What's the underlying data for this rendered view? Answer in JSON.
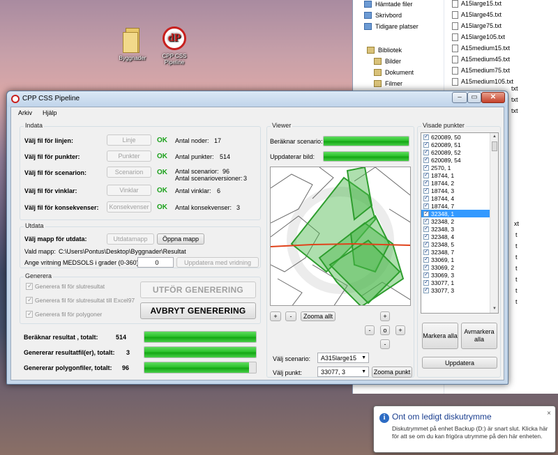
{
  "desktop": {
    "icons": [
      {
        "label": "Byggnader"
      },
      {
        "label": "CPP CSS Pipeline"
      }
    ]
  },
  "explorer": {
    "nav": [
      "Hämtade filer",
      "Skrivbord",
      "Tidigare platser",
      "Bibliotek",
      "Bilder",
      "Dokument",
      "Filmer"
    ],
    "files": [
      "A15large15.txt",
      "A15large45.txt",
      "A15large75.txt",
      "A15large105.txt",
      "A15medium15.txt",
      "A15medium45.txt",
      "A15medium75.txt",
      "A15medium105.txt"
    ],
    "right_stubs": [
      "txt",
      "txt",
      "txt",
      "xt",
      "t",
      "t",
      "t",
      "t",
      "t",
      "t",
      "t"
    ]
  },
  "window": {
    "title": "CPP CSS Pipeline",
    "menu": [
      "Arkiv",
      "Hjälp"
    ],
    "indata": {
      "title": "Indata",
      "rows": [
        {
          "label": "Välj fil för linjen:",
          "button": "Linje",
          "status": "OK",
          "info": "Antal noder:",
          "value": "17"
        },
        {
          "label": "Välj fil för punkter:",
          "button": "Punkter",
          "status": "OK",
          "info": "Antal punkter:",
          "value": "514"
        },
        {
          "label": "Välj fil för scenarion:",
          "button": "Scenarion",
          "status": "OK",
          "info": "Antal scenarior:",
          "value": "96",
          "info2": "Antal scenarioversioner:",
          "value2": "3"
        },
        {
          "label": "Välj fil för vinklar:",
          "button": "Vinklar",
          "status": "OK",
          "info": "Antal vinklar:",
          "value": "6"
        },
        {
          "label": "Välj fil för konsekvenser:",
          "button": "Konsekvenser",
          "status": "OK",
          "info": "Antal konsekvenser:",
          "value": "3"
        }
      ]
    },
    "utdata": {
      "title": "Utdata",
      "label": "Välj mapp för utdata:",
      "button": "Utdatamapp",
      "open_button": "Öppna mapp",
      "chosen_label": "Vald mapp:",
      "chosen_path": "C:\\Users\\Pontus\\Desktop\\Byggnader\\Resultat",
      "angle_label": "Ange vritning MEDSOLS i grader (0-360):",
      "angle_value": "0",
      "update_button": "Uppdatera med vridning"
    },
    "generera": {
      "title": "Generera",
      "checkboxes": [
        "Generera fil för slutresultat",
        "Generera fil för slutresultat till Excel97",
        "Generera fil för polygoner"
      ],
      "run_button": "UTFÖR GENERERING",
      "abort_button": "AVBRYT GENERERING"
    },
    "progress": [
      {
        "label": "Beräknar resultat , totalt:",
        "value": "514",
        "fraction": 1.0
      },
      {
        "label": "Genererar resultatfil(er), totalt:",
        "value": "3",
        "fraction": 1.0
      },
      {
        "label": "Genererar polygonfiler, totalt:",
        "value": "96",
        "fraction": 0.94
      }
    ],
    "viewer": {
      "title": "Viewer",
      "calc_label": "Beräknar scenario:",
      "update_label": "Uppdaterar bild:",
      "calc_fraction": 1.0,
      "update_fraction": 1.0,
      "plus": "+",
      "minus": "-",
      "zoom_all": "Zooma allt",
      "nav_plus_up": "+",
      "nav_minus_left": "-",
      "nav_center": "o",
      "nav_plus_right": "+",
      "nav_minus_down": "-",
      "scenario_label": "Välj scenario:",
      "scenario_value": "A315large15",
      "point_label": "Välj punkt:",
      "point_value": "33077, 3",
      "zoom_point": "Zooma punkt"
    },
    "visade": {
      "title": "Visade punkter",
      "items": [
        "620089, 50",
        "620089, 51",
        "620089, 52",
        "620089, 54",
        "2570, 1",
        "18744, 1",
        "18744, 2",
        "18744, 3",
        "18744, 4",
        "18744, 7",
        "32348, 1",
        "32348, 2",
        "32348, 3",
        "32348, 4",
        "32348, 5",
        "32348, 7",
        "33069, 1",
        "33069, 2",
        "33069, 3",
        "33077, 1",
        "33077, 3"
      ],
      "selected_index": 10,
      "mark_all": "Markera alla",
      "unmark_all": "Avmarkera alla",
      "update": "Uppdatera"
    }
  },
  "notification": {
    "title": "Ont om ledigt diskutrymme",
    "body": "Diskutrymmet på enhet Backup (D:) är snart slut. Klicka här för att se om du kan frigöra utrymme på den här enheten.",
    "close": "×"
  },
  "colors": {
    "ok_green": "#1ba11b",
    "progress_green": "#2cc22c",
    "selection_blue": "#3399ff",
    "polygon_green": "#2e9e2e",
    "line_red": "#e0421a"
  }
}
